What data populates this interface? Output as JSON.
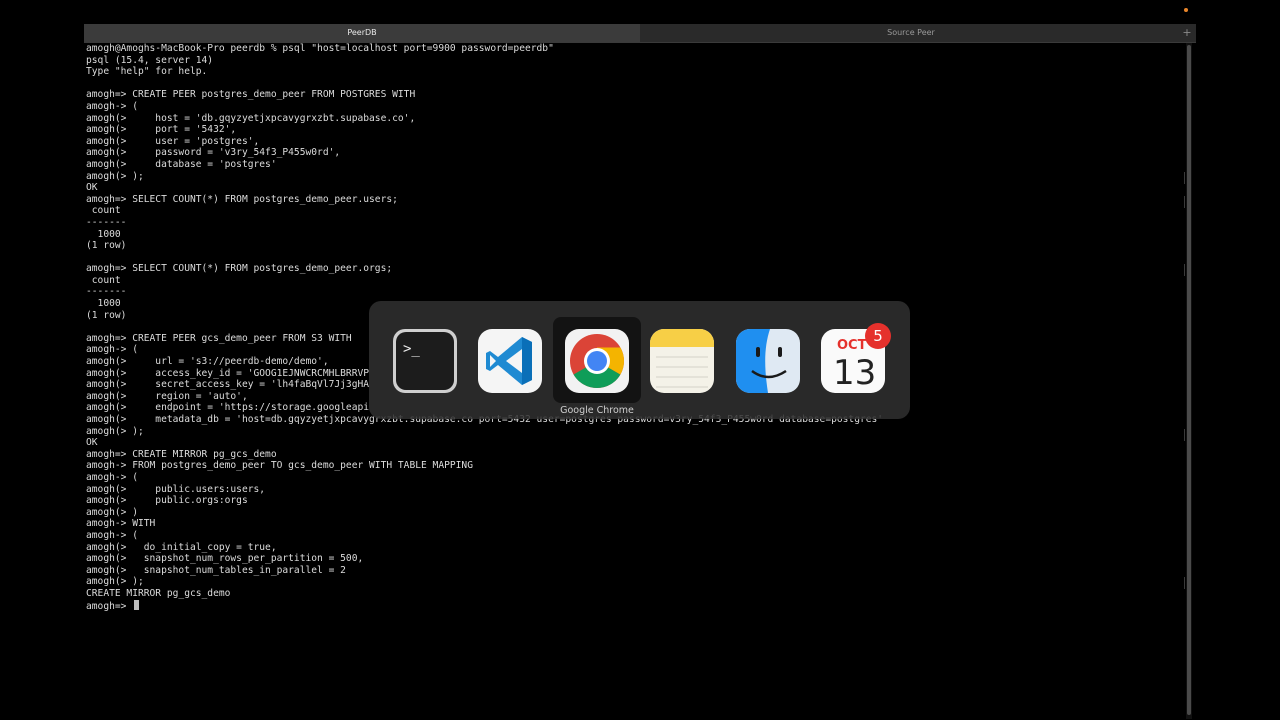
{
  "tabs": {
    "active": "PeerDB",
    "inactive": "Source Peer",
    "add": "+"
  },
  "terminal": {
    "lines": [
      "amogh@Amoghs-MacBook-Pro peerdb % psql \"host=localhost port=9900 password=peerdb\"",
      "psql (15.4, server 14)",
      "Type \"help\" for help.",
      "",
      "amogh=> CREATE PEER postgres_demo_peer FROM POSTGRES WITH",
      "amogh-> (",
      "amogh(>     host = 'db.gqyzyetjxpcavygrxzbt.supabase.co',",
      "amogh(>     port = '5432',",
      "amogh(>     user = 'postgres',",
      "amogh(>     password = 'v3ry_54f3_P455w0rd',",
      "amogh(>     database = 'postgres'",
      "amogh(> );",
      "OK",
      "amogh=> SELECT COUNT(*) FROM postgres_demo_peer.users;",
      " count",
      "-------",
      "  1000",
      "(1 row)",
      "",
      "amogh=> SELECT COUNT(*) FROM postgres_demo_peer.orgs;",
      " count",
      "-------",
      "  1000",
      "(1 row)",
      "",
      "amogh=> CREATE PEER gcs_demo_peer FROM S3 WITH",
      "amogh-> (",
      "amogh(>     url = 's3://peerdb-demo/demo',",
      "amogh(>     access_key_id = 'GOOG1EJNWCRCMHLBRRVP",
      "amogh(>     secret_access_key = 'lh4faBqVl7Jj3gHA",
      "amogh(>     region = 'auto',",
      "amogh(>     endpoint = 'https://storage.googleapi",
      "amogh(>     metadata_db = 'host=db.gqyzyetjxpcavygrxzbt.supabase.co port=5432 user=postgres password=v3ry_54f3_P455w0rd database=postgres'",
      "amogh(> );",
      "OK",
      "amogh=> CREATE MIRROR pg_gcs_demo",
      "amogh-> FROM postgres_demo_peer TO gcs_demo_peer WITH TABLE MAPPING",
      "amogh-> (",
      "amogh(>     public.users:users,",
      "amogh(>     public.orgs:orgs",
      "amogh(> )",
      "amogh-> WITH",
      "amogh-> (",
      "amogh(>   do_initial_copy = true,",
      "amogh(>   snapshot_num_rows_per_partition = 500,",
      "amogh(>   snapshot_num_tables_in_parallel = 2",
      "amogh(> );",
      "CREATE MIRROR pg_gcs_demo"
    ],
    "prompt": "amogh=> "
  },
  "app_switcher": {
    "selected_label": "Google Chrome",
    "apps": [
      {
        "name": "Terminal",
        "icon": "terminal-icon"
      },
      {
        "name": "Visual Studio Code",
        "icon": "vscode-icon"
      },
      {
        "name": "Google Chrome",
        "icon": "chrome-icon"
      },
      {
        "name": "Notes",
        "icon": "notes-icon"
      },
      {
        "name": "Finder",
        "icon": "finder-icon"
      },
      {
        "name": "Calendar",
        "icon": "calendar-icon"
      }
    ],
    "calendar": {
      "month": "OCT",
      "day": "13",
      "badge": "5"
    },
    "terminal_prompt_glyph": ">_"
  },
  "colors": {
    "background": "#000000",
    "text": "#dcdcdc",
    "badge": "#e5312c",
    "chrome_red": "#db4437",
    "chrome_yellow": "#f4b400",
    "chrome_green": "#0f9d58",
    "chrome_blue": "#4285f4"
  }
}
